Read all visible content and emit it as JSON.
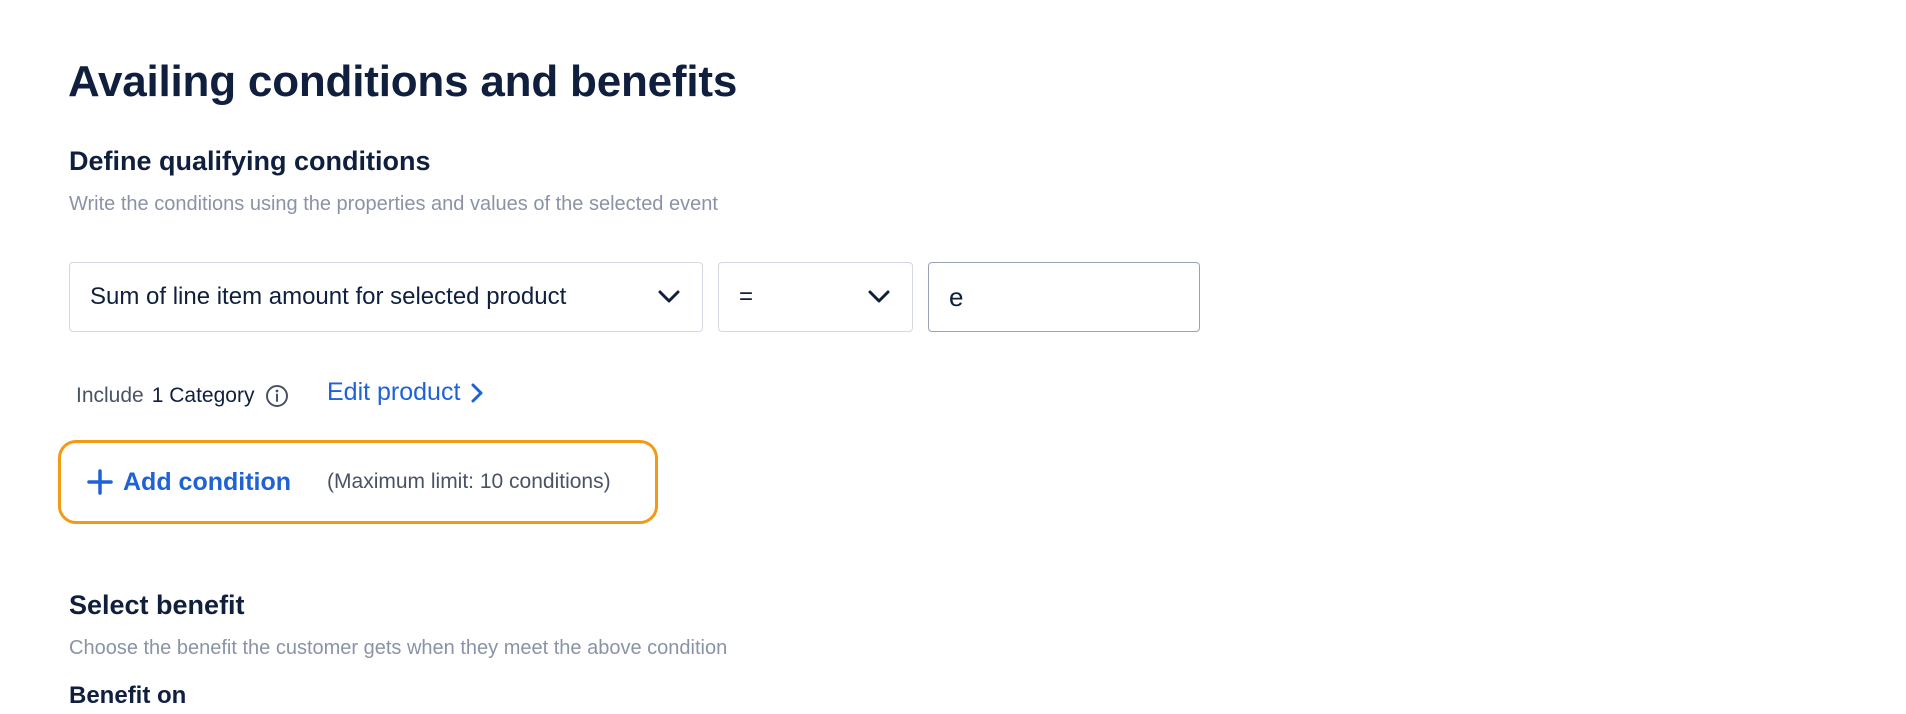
{
  "page": {
    "title": "Availing conditions and benefits"
  },
  "conditions": {
    "heading": "Define qualifying conditions",
    "description": "Write the conditions using the properties and values of the selected event",
    "property_select": {
      "value": "Sum of line item amount for selected product",
      "icon": "chevron-down-icon"
    },
    "operator_select": {
      "value": "=",
      "icon": "chevron-down-icon"
    },
    "value_input": {
      "value": "e",
      "placeholder": ""
    },
    "include": {
      "label": "Include",
      "count": "1 Category",
      "icon": "info-icon"
    },
    "edit_product": {
      "label": "Edit product",
      "icon": "chevron-right-icon"
    },
    "add_condition": {
      "label": "Add condition",
      "icon": "plus-icon",
      "limit_note": "(Maximum limit: 10 conditions)"
    }
  },
  "benefit": {
    "heading": "Select benefit",
    "description": "Choose the benefit the customer gets when they meet the above condition",
    "benefit_on_label": "Benefit on"
  },
  "colors": {
    "text_primary": "#0f1f3d",
    "text_secondary": "#8a93a6",
    "link": "#1e62d6",
    "highlight": "#f29a16",
    "border": "#d3d8e1"
  }
}
